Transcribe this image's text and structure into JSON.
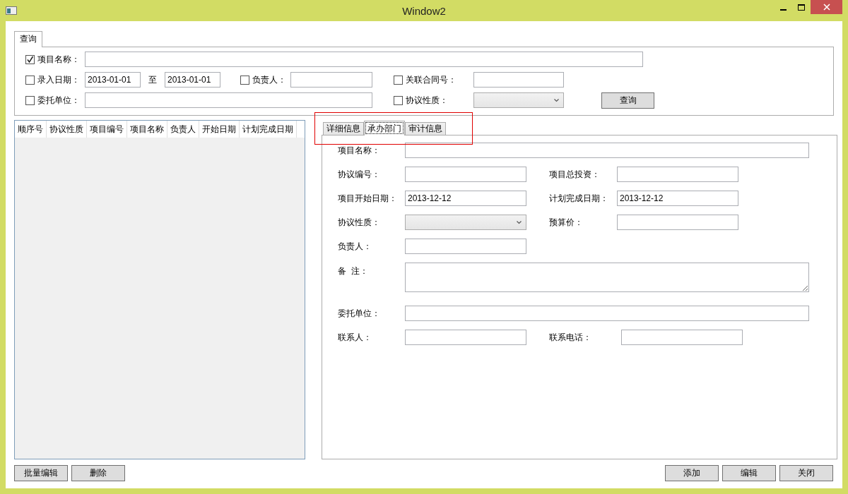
{
  "window": {
    "title": "Window2"
  },
  "query": {
    "tab": "查询",
    "filters": [
      {
        "label": "项目名称：",
        "checked": true
      },
      {
        "label": "录入日期：",
        "checked": false,
        "from": "2013-01-01",
        "separator": "至",
        "to": "2013-01-01"
      },
      {
        "label": "负责人：",
        "checked": false
      },
      {
        "label": "关联合同号：",
        "checked": false
      },
      {
        "label": "委托单位：",
        "checked": false
      },
      {
        "label": "协议性质：",
        "checked": false
      }
    ],
    "search_button": "查询"
  },
  "table": {
    "columns": [
      "顺序号",
      "协议性质",
      "项目编号",
      "项目名称",
      "负责人",
      "开始日期",
      "计划完成日期"
    ]
  },
  "detail_tabs": [
    {
      "label": "详细信息",
      "selected": false
    },
    {
      "label": "承办部门",
      "selected": true
    },
    {
      "label": "审计信息",
      "selected": false
    }
  ],
  "form_rows": [
    [
      {
        "label": "项目名称：",
        "kind": "wide"
      }
    ],
    [
      {
        "label": "协议编号：",
        "kind": "text"
      },
      {
        "label": "项目总投资：",
        "kind": "text"
      }
    ],
    [
      {
        "label": "项目开始日期：",
        "kind": "text",
        "value": "2013-12-12"
      },
      {
        "label": "计划完成日期：",
        "kind": "text",
        "value": "2013-12-12"
      }
    ],
    [
      {
        "label": "协议性质：",
        "kind": "combo"
      },
      {
        "label": "预算价：",
        "kind": "text"
      }
    ],
    [
      {
        "label": "负责人：",
        "kind": "text"
      }
    ],
    [
      {
        "label": "备  注：",
        "kind": "memo"
      }
    ],
    [
      {
        "label": "委托单位：",
        "kind": "wide"
      }
    ],
    [
      {
        "label": "联系人：",
        "kind": "text"
      },
      {
        "label": "联系电话：",
        "kind": "text"
      }
    ]
  ],
  "left_buttons": [
    "批量编辑",
    "删除"
  ],
  "right_buttons": [
    "添加",
    "编辑",
    "关闭"
  ]
}
